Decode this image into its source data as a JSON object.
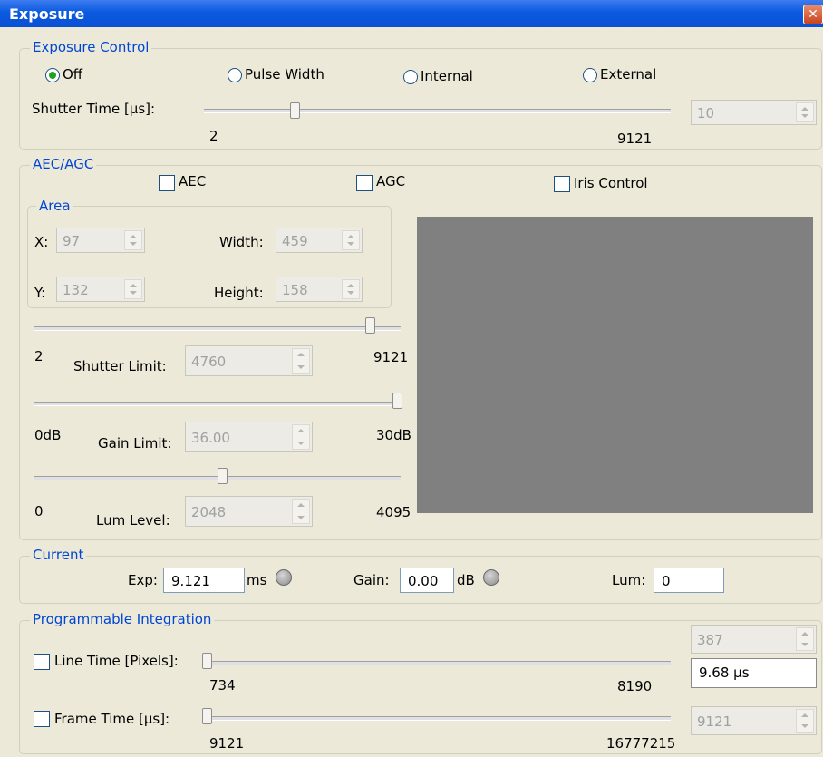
{
  "window": {
    "title": "Exposure",
    "close": "✕"
  },
  "exposure_control": {
    "title": "Exposure Control",
    "modes": [
      {
        "label": "Off",
        "selected": true
      },
      {
        "label": "Pulse Width",
        "selected": false
      },
      {
        "label": "Internal",
        "selected": false
      },
      {
        "label": "External",
        "selected": false
      }
    ],
    "shutter_label": "Shutter Time [µs]:",
    "shutter_min": "2",
    "shutter_max": "9121",
    "shutter_value": "10"
  },
  "aec_agc": {
    "title": "AEC/AGC",
    "aec_label": "AEC",
    "agc_label": "AGC",
    "iris_label": "Iris Control",
    "area": {
      "title": "Area",
      "x_label": "X:",
      "x_value": "97",
      "y_label": "Y:",
      "y_value": "132",
      "width_label": "Width:",
      "width_value": "459",
      "height_label": "Height:",
      "height_value": "158"
    },
    "shutter_limit": {
      "label": "Shutter Limit:",
      "min": "2",
      "max": "9121",
      "value": "4760"
    },
    "gain_limit": {
      "label": "Gain Limit:",
      "min": "0dB",
      "max": "30dB",
      "value": "36.00"
    },
    "lum_level": {
      "label": "Lum Level:",
      "min": "0",
      "max": "4095",
      "value": "2048"
    }
  },
  "current": {
    "title": "Current",
    "exp_label": "Exp:",
    "exp_value": "9.121",
    "exp_unit": "ms",
    "gain_label": "Gain:",
    "gain_value": "0.00",
    "gain_unit": "dB",
    "lum_label": "Lum:",
    "lum_value": "0"
  },
  "programmable": {
    "title": "Programmable Integration",
    "line_label": "Line Time [Pixels]:",
    "line_min": "734",
    "line_max": "8190",
    "line_value": "387",
    "line_time": "9.68 µs",
    "frame_label": "Frame Time [µs]:",
    "frame_min": "9121",
    "frame_max": "16777215",
    "frame_value": "9121"
  }
}
